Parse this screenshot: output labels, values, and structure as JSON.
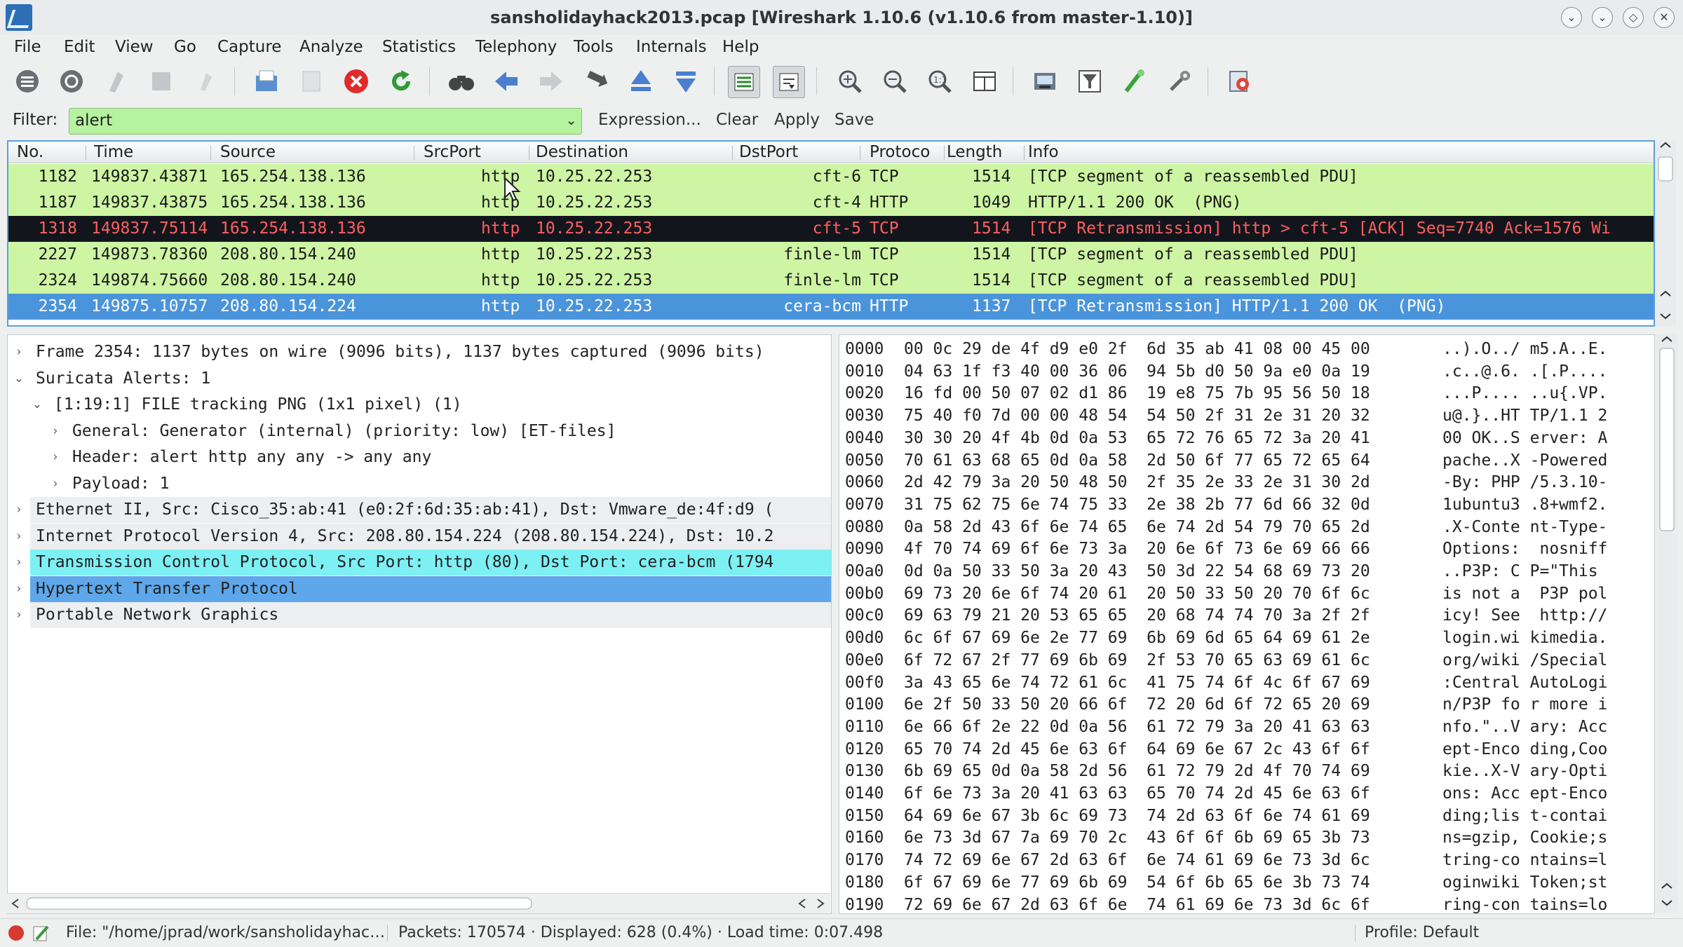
{
  "window": {
    "title": "sansholidayhack2013.pcap   [Wireshark 1.10.6  (v1.10.6 from master-1.10)]"
  },
  "menu": [
    "File",
    "Edit",
    "View",
    "Go",
    "Capture",
    "Analyze",
    "Statistics",
    "Telephony",
    "Tools",
    "Internals",
    "Help"
  ],
  "toolbar": {
    "icons": [
      "interfaces-icon",
      "options-icon",
      "start-capture-icon",
      "stop-capture-icon",
      "restart-capture-icon",
      "open-file-icon",
      "save-file-icon",
      "close-file-icon",
      "reload-icon",
      "find-packet-icon",
      "go-back-icon",
      "go-forward-icon",
      "go-to-packet-icon",
      "go-first-icon",
      "go-last-icon",
      "colorize-icon",
      "auto-scroll-icon",
      "zoom-in-icon",
      "zoom-out-icon",
      "zoom-normal-icon",
      "resize-columns-icon",
      "capture-filters-icon",
      "display-filters-icon",
      "coloring-rules-icon",
      "preferences-icon",
      "help-icon"
    ]
  },
  "filter": {
    "label": "Filter:",
    "value": "alert",
    "buttons": [
      "Expression...",
      "Clear",
      "Apply",
      "Save"
    ]
  },
  "packet_list": {
    "columns": [
      "No.",
      "Time",
      "Source",
      "SrcPort",
      "Destination",
      "DstPort",
      "Protoco",
      "Length",
      "Info"
    ],
    "rows": [
      {
        "no": "1182",
        "time": "149837.43871",
        "source": "165.254.138.136",
        "srcport": "http",
        "dest": "10.25.22.253",
        "dstport": "cft-6",
        "proto": "TCP",
        "len": "1514",
        "info": "[TCP segment of a reassembled PDU]",
        "style": "green"
      },
      {
        "no": "1187",
        "time": "149837.43875",
        "source": "165.254.138.136",
        "srcport": "http",
        "dest": "10.25.22.253",
        "dstport": "cft-4",
        "proto": "HTTP",
        "len": "1049",
        "info": "HTTP/1.1 200 OK  (PNG)",
        "style": "green"
      },
      {
        "no": "1318",
        "time": "149837.75114",
        "source": "165.254.138.136",
        "srcport": "http",
        "dest": "10.25.22.253",
        "dstport": "cft-5",
        "proto": "TCP",
        "len": "1514",
        "info": "[TCP Retransmission] http > cft-5 [ACK] Seq=7740 Ack=1576 Wi",
        "style": "bad"
      },
      {
        "no": "2227",
        "time": "149873.78360",
        "source": "208.80.154.240",
        "srcport": "http",
        "dest": "10.25.22.253",
        "dstport": "finle-lm",
        "proto": "TCP",
        "len": "1514",
        "info": "[TCP segment of a reassembled PDU]",
        "style": "green"
      },
      {
        "no": "2324",
        "time": "149874.75660",
        "source": "208.80.154.240",
        "srcport": "http",
        "dest": "10.25.22.253",
        "dstport": "finle-lm",
        "proto": "TCP",
        "len": "1514",
        "info": "[TCP segment of a reassembled PDU]",
        "style": "green"
      },
      {
        "no": "2354",
        "time": "149875.10757",
        "source": "208.80.154.224",
        "srcport": "http",
        "dest": "10.25.22.253",
        "dstport": "cera-bcm",
        "proto": "HTTP",
        "len": "1137",
        "info": "[TCP Retransmission] HTTP/1.1 200 OK  (PNG)",
        "style": "selected"
      }
    ]
  },
  "details": [
    {
      "indent": 0,
      "exp": "›",
      "text": "Frame 2354: 1137 bytes on wire (9096 bits), 1137 bytes captured (9096 bits)",
      "style": "normal"
    },
    {
      "indent": 0,
      "exp": "⌄",
      "text": "Suricata Alerts: 1",
      "style": "normal"
    },
    {
      "indent": 1,
      "exp": "⌄",
      "text": "[1:19:1] FILE tracking PNG (1x1 pixel) (1)",
      "style": "normal"
    },
    {
      "indent": 2,
      "exp": "›",
      "text": "General: Generator (internal) (priority: low) [ET-files]",
      "style": "normal"
    },
    {
      "indent": 2,
      "exp": "›",
      "text": "Header: alert http any any -> any any",
      "style": "normal"
    },
    {
      "indent": 2,
      "exp": "›",
      "text": "Payload: 1",
      "style": "normal"
    },
    {
      "indent": 0,
      "exp": "›",
      "text": "Ethernet II, Src: Cisco_35:ab:41 (e0:2f:6d:35:ab:41), Dst: Vmware_de:4f:d9 (",
      "style": "gray"
    },
    {
      "indent": 0,
      "exp": "›",
      "text": "Internet Protocol Version 4, Src: 208.80.154.224 (208.80.154.224), Dst: 10.2",
      "style": "gray"
    },
    {
      "indent": 0,
      "exp": "›",
      "text": "Transmission Control Protocol, Src Port: http (80), Dst Port: cera-bcm (1794",
      "style": "cyan"
    },
    {
      "indent": 0,
      "exp": "›",
      "text": "Hypertext Transfer Protocol",
      "style": "blue"
    },
    {
      "indent": 0,
      "exp": "›",
      "text": "Portable Network Graphics",
      "style": "gray"
    }
  ],
  "bytes": [
    {
      "off": "0000",
      "hex": "00 0c 29 de 4f d9 e0 2f  6d 35 ab 41 08 00 45 00",
      "ascii": "..).O../ m5.A..E."
    },
    {
      "off": "0010",
      "hex": "04 63 1f f3 40 00 36 06  94 5b d0 50 9a e0 0a 19",
      "ascii": ".c..@.6. .[.P...."
    },
    {
      "off": "0020",
      "hex": "16 fd 00 50 07 02 d1 86  19 e8 75 7b 95 56 50 18",
      "ascii": "...P.... ..u{.VP."
    },
    {
      "off": "0030",
      "hex": "75 40 f0 7d 00 00 48 54  54 50 2f 31 2e 31 20 32",
      "ascii": "u@.}..HT TP/1.1 2"
    },
    {
      "off": "0040",
      "hex": "30 30 20 4f 4b 0d 0a 53  65 72 76 65 72 3a 20 41",
      "ascii": "00 OK..S erver: A"
    },
    {
      "off": "0050",
      "hex": "70 61 63 68 65 0d 0a 58  2d 50 6f 77 65 72 65 64",
      "ascii": "pache..X -Powered"
    },
    {
      "off": "0060",
      "hex": "2d 42 79 3a 20 50 48 50  2f 35 2e 33 2e 31 30 2d",
      "ascii": "-By: PHP /5.3.10-"
    },
    {
      "off": "0070",
      "hex": "31 75 62 75 6e 74 75 33  2e 38 2b 77 6d 66 32 0d",
      "ascii": "1ubuntu3 .8+wmf2."
    },
    {
      "off": "0080",
      "hex": "0a 58 2d 43 6f 6e 74 65  6e 74 2d 54 79 70 65 2d",
      "ascii": ".X-Conte nt-Type-"
    },
    {
      "off": "0090",
      "hex": "4f 70 74 69 6f 6e 73 3a  20 6e 6f 73 6e 69 66 66",
      "ascii": "Options:  nosniff"
    },
    {
      "off": "00a0",
      "hex": "0d 0a 50 33 50 3a 20 43  50 3d 22 54 68 69 73 20",
      "ascii": "..P3P: C P=\"This "
    },
    {
      "off": "00b0",
      "hex": "69 73 20 6e 6f 74 20 61  20 50 33 50 20 70 6f 6c",
      "ascii": "is not a  P3P pol"
    },
    {
      "off": "00c0",
      "hex": "69 63 79 21 20 53 65 65  20 68 74 74 70 3a 2f 2f",
      "ascii": "icy! See  http://"
    },
    {
      "off": "00d0",
      "hex": "6c 6f 67 69 6e 2e 77 69  6b 69 6d 65 64 69 61 2e",
      "ascii": "login.wi kimedia."
    },
    {
      "off": "00e0",
      "hex": "6f 72 67 2f 77 69 6b 69  2f 53 70 65 63 69 61 6c",
      "ascii": "org/wiki /Special"
    },
    {
      "off": "00f0",
      "hex": "3a 43 65 6e 74 72 61 6c  41 75 74 6f 4c 6f 67 69",
      "ascii": ":Central AutoLogi"
    },
    {
      "off": "0100",
      "hex": "6e 2f 50 33 50 20 66 6f  72 20 6d 6f 72 65 20 69",
      "ascii": "n/P3P fo r more i"
    },
    {
      "off": "0110",
      "hex": "6e 66 6f 2e 22 0d 0a 56  61 72 79 3a 20 41 63 63",
      "ascii": "nfo.\"..V ary: Acc"
    },
    {
      "off": "0120",
      "hex": "65 70 74 2d 45 6e 63 6f  64 69 6e 67 2c 43 6f 6f",
      "ascii": "ept-Enco ding,Coo"
    },
    {
      "off": "0130",
      "hex": "6b 69 65 0d 0a 58 2d 56  61 72 79 2d 4f 70 74 69",
      "ascii": "kie..X-V ary-Opti"
    },
    {
      "off": "0140",
      "hex": "6f 6e 73 3a 20 41 63 63  65 70 74 2d 45 6e 63 6f",
      "ascii": "ons: Acc ept-Enco"
    },
    {
      "off": "0150",
      "hex": "64 69 6e 67 3b 6c 69 73  74 2d 63 6f 6e 74 61 69",
      "ascii": "ding;lis t-contai"
    },
    {
      "off": "0160",
      "hex": "6e 73 3d 67 7a 69 70 2c  43 6f 6f 6b 69 65 3b 73",
      "ascii": "ns=gzip, Cookie;s"
    },
    {
      "off": "0170",
      "hex": "74 72 69 6e 67 2d 63 6f  6e 74 61 69 6e 73 3d 6c",
      "ascii": "tring-co ntains=l"
    },
    {
      "off": "0180",
      "hex": "6f 67 69 6e 77 69 6b 69  54 6f 6b 65 6e 3b 73 74",
      "ascii": "oginwiki Token;st"
    },
    {
      "off": "0190",
      "hex": "72 69 6e 67 2d 63 6f 6e  74 61 69 6e 73 3d 6c 6f",
      "ascii": "ring-con tains=lo"
    }
  ],
  "status": {
    "file": "File: \"/home/jprad/work/sansholidayhac…",
    "packets": "Packets: 170574 · Displayed: 628 (0.4%) · Load time: 0:07.498",
    "profile": "Profile: Default"
  },
  "colors": {
    "green_row": "#cdf5a3",
    "bad_row_bg": "#12161c",
    "bad_row_fg": "#ff5f5f",
    "selected_row": "#4a94dc",
    "filter_ok": "#b6f3a1",
    "tcp_highlight": "#7df0f3",
    "http_highlight": "#5ea7ea"
  }
}
